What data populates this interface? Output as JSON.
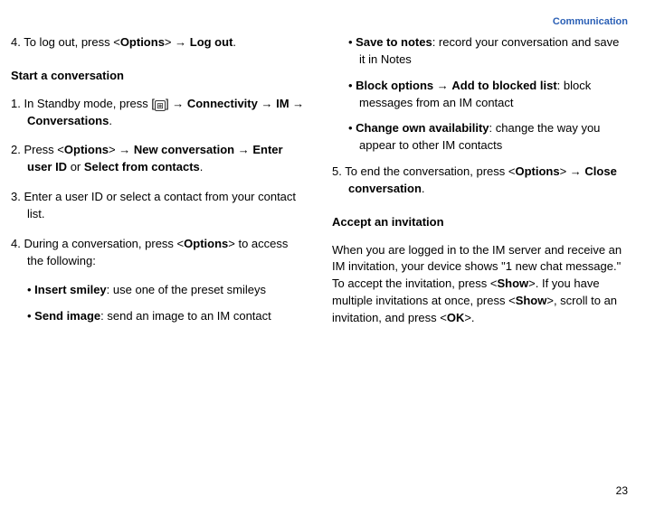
{
  "header": {
    "section": "Communication"
  },
  "page_number": "23",
  "left": {
    "step4_logout_a": "4. To log out, press <",
    "step4_logout_b": "Options",
    "step4_logout_c": "> → ",
    "step4_logout_d": "Log out",
    "step4_logout_e": ".",
    "heading1": "Start a conversation",
    "s1_a": "1. In Standby mode, press [",
    "s1_b": "] → ",
    "s1_c": "Connectivity",
    "s1_d": " → ",
    "s1_e": "IM",
    "s1_f": " → ",
    "s1_g": "Conversations",
    "s1_h": ".",
    "s2_a": "2. Press <",
    "s2_b": "Options",
    "s2_c": "> → ",
    "s2_d": "New conversation",
    "s2_e": " → ",
    "s2_f": "Enter user ID",
    "s2_g": " or ",
    "s2_h": "Select from contacts",
    "s2_i": ".",
    "s3": "3. Enter a user ID or select a contact from your contact list.",
    "s4_a": "4. During a conversation, press <",
    "s4_b": "Options",
    "s4_c": "> to access the following:",
    "b1_a": "Insert smiley",
    "b1_b": ": use one of the preset smileys",
    "b2_a": "Send image",
    "b2_b": ": send an image to an IM contact"
  },
  "right": {
    "b3_a": "Save to notes",
    "b3_b": ": record your conversation and save it in Notes",
    "b4_a": "Block options",
    "b4_b": " → ",
    "b4_c": "Add to blocked list",
    "b4_d": ": block messages from an IM contact",
    "b5_a": "Change own availability",
    "b5_b": ": change the way you appear to other IM contacts",
    "s5_a": "5. To end the conversation, press <",
    "s5_b": "Options",
    "s5_c": "> → ",
    "s5_d": "Close conversation",
    "s5_e": ".",
    "heading2": "Accept an invitation",
    "para_a": "When you are logged in to the IM server and receive an IM invitation, your device shows \"1 new chat message.\" To accept the invitation, press <",
    "para_b": "Show",
    "para_c": ">. If you have multiple invitations at once, press <",
    "para_d": "Show",
    "para_e": ">, scroll to an invitation, and press <",
    "para_f": "OK",
    "para_g": ">."
  }
}
